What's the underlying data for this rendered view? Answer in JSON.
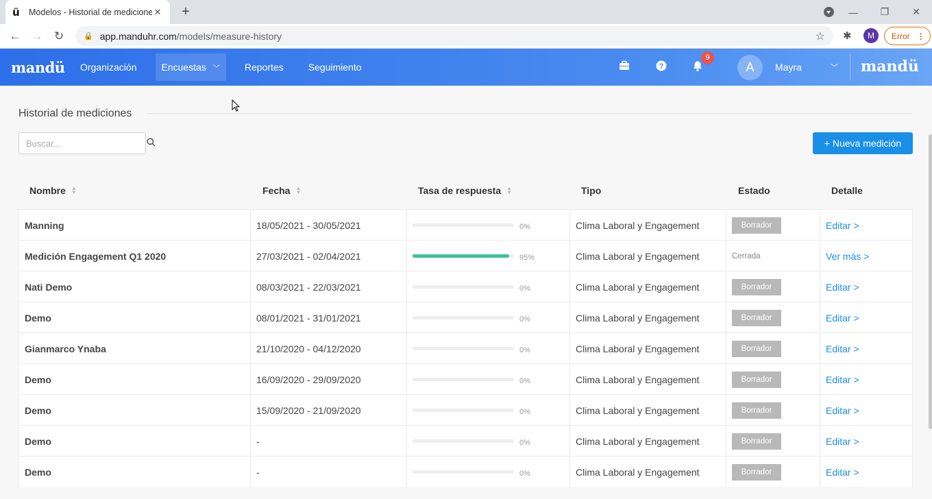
{
  "browser": {
    "tab_title": "Modelos - Historial de medicione",
    "tab_favicon": "ü",
    "url_host": "app.manduhr.com",
    "url_path": "/models/measure-history",
    "profile_initial": "M",
    "error_label": "Error"
  },
  "app": {
    "logo": "mandü",
    "nav": [
      {
        "label": "Organización"
      },
      {
        "label": "Encuestas"
      },
      {
        "label": "Reportes"
      },
      {
        "label": "Seguimiento"
      }
    ],
    "notification_count": "9",
    "user_initial": "A",
    "user_name": "Mayra",
    "logo_right": "mandü"
  },
  "page": {
    "title": "Historial de mediciones",
    "search_placeholder": "Buscar...",
    "new_button": "+ Nueva medición"
  },
  "table": {
    "headers": {
      "name": "Nombre",
      "date": "Fecha",
      "rate": "Tasa de respuesta",
      "type": "Tipo",
      "state": "Estado",
      "detail": "Detalle"
    },
    "rows": [
      {
        "name": "Manning",
        "date": "18/05/2021 - 30/05/2021",
        "rate": 0,
        "rate_label": "0%",
        "type": "Clima Laboral y Engagement",
        "state": "Borrador",
        "state_style": "chip",
        "detail": "Editar >"
      },
      {
        "name": "Medición Engagement Q1 2020",
        "date": "27/03/2021 - 02/04/2021",
        "rate": 95,
        "rate_label": "95%",
        "type": "Clima Laboral y Engagement",
        "state": "Cerrada",
        "state_style": "text",
        "detail": "Ver más >"
      },
      {
        "name": "Nati Demo",
        "date": "08/03/2021 - 22/03/2021",
        "rate": 0,
        "rate_label": "0%",
        "type": "Clima Laboral y Engagement",
        "state": "Borrador",
        "state_style": "chip",
        "detail": "Editar >"
      },
      {
        "name": "Demo",
        "date": "08/01/2021 - 31/01/2021",
        "rate": 0,
        "rate_label": "0%",
        "type": "Clima Laboral y Engagement",
        "state": "Borrador",
        "state_style": "chip",
        "detail": "Editar >"
      },
      {
        "name": "Gianmarco Ynaba",
        "date": "21/10/2020 - 04/12/2020",
        "rate": 0,
        "rate_label": "0%",
        "type": "Clima Laboral y Engagement",
        "state": "Borrador",
        "state_style": "chip",
        "detail": "Editar >"
      },
      {
        "name": "Demo",
        "date": "16/09/2020 - 29/09/2020",
        "rate": 0,
        "rate_label": "0%",
        "type": "Clima Laboral y Engagement",
        "state": "Borrador",
        "state_style": "chip",
        "detail": "Editar >"
      },
      {
        "name": "Demo",
        "date": "15/09/2020 - 21/09/2020",
        "rate": 0,
        "rate_label": "0%",
        "type": "Clima Laboral y Engagement",
        "state": "Borrador",
        "state_style": "chip",
        "detail": "Editar >"
      },
      {
        "name": "Demo",
        "date": "-",
        "rate": 0,
        "rate_label": "0%",
        "type": "Clima Laboral y Engagement",
        "state": "Borrador",
        "state_style": "chip",
        "detail": "Editar >"
      },
      {
        "name": "Demo",
        "date": "-",
        "rate": 0,
        "rate_label": "0%",
        "type": "Clima Laboral y Engagement",
        "state": "Borrador",
        "state_style": "chip",
        "detail": "Editar >"
      }
    ]
  },
  "colors": {
    "primary": "#1a8fe8",
    "progress": "#3cc49d",
    "chip": "#b9b9b9",
    "badge": "#e9524f"
  },
  "icons": {
    "briefcase": "briefcase-icon",
    "help": "help-icon",
    "bell": "bell-icon",
    "search": "search-icon"
  }
}
